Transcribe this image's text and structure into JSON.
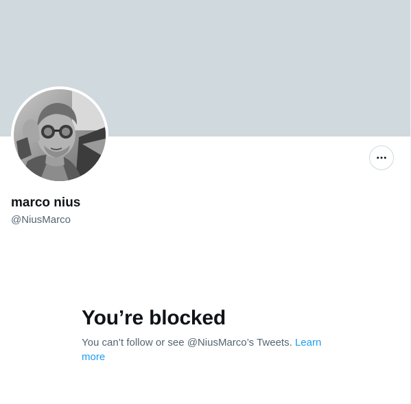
{
  "profile": {
    "display_name": "marco nius",
    "handle": "@NiusMarco",
    "avatar_icon": "profile-photo",
    "banner_color": "#cfd9de"
  },
  "actions": {
    "more_icon": "more-horizontal-icon"
  },
  "blocked": {
    "title": "You’re blocked",
    "description": "You can’t follow or see @NiusMarco’s Tweets.",
    "learn_more": "Learn more",
    "link_color": "#1d9bf0"
  }
}
